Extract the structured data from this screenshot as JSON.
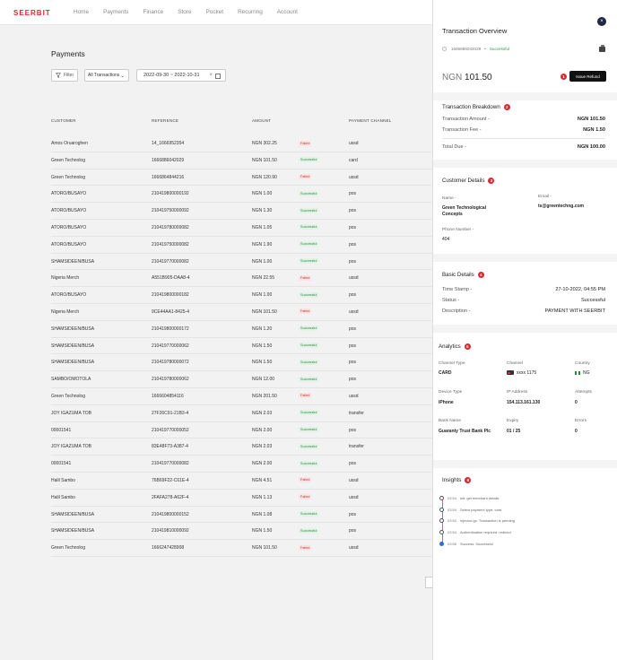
{
  "topbar": {
    "logo": "SEERBIT",
    "nav": [
      "Home",
      "Payments",
      "Finance",
      "Store",
      "Pocket",
      "Recurring",
      "Account"
    ]
  },
  "main": {
    "title": "Payments",
    "filter_label": "Filter",
    "type_select": "All Transactions",
    "date_range": "2022-09-30 ~ 2022-10-31",
    "columns": [
      "CUSTOMER",
      "REFERENCE",
      "AMOUNT",
      "PAYMENT CHANNEL"
    ],
    "rows": [
      {
        "customer": "Amos Oruaroghen",
        "reference": "14_1666952354",
        "amount": "NGN 302.25",
        "status": "Failed",
        "channel": "ussd"
      },
      {
        "customer": "Green Technolog",
        "reference": "1666886042029",
        "amount": "NGN 101.50",
        "status": "Successful",
        "channel": "card"
      },
      {
        "customer": "Green Technolog",
        "reference": "1666864844216",
        "amount": "NGN 120.90",
        "status": "Failed",
        "channel": "ussd"
      },
      {
        "customer": "ATORO/BUSAYO",
        "reference": "210419800000192",
        "amount": "NGN 1.00",
        "status": "Successful",
        "channel": "pos"
      },
      {
        "customer": "ATORO/BUSAYO",
        "reference": "210419750000092",
        "amount": "NGN 1.30",
        "status": "Successful",
        "channel": "pos"
      },
      {
        "customer": "ATORO/BUSAYO",
        "reference": "210419780000082",
        "amount": "NGN 1.05",
        "status": "Successful",
        "channel": "pos"
      },
      {
        "customer": "ATORO/BUSAYO",
        "reference": "210419750000082",
        "amount": "NGN 1.90",
        "status": "Successful",
        "channel": "pos"
      },
      {
        "customer": "SHAMSIDEEN/BUSA",
        "reference": "210419770000082",
        "amount": "NGN 1.00",
        "status": "Successful",
        "channel": "pos"
      },
      {
        "customer": "Nigeria Merch",
        "reference": "A551B905-DAA8-4",
        "amount": "NGN 22.55",
        "status": "Failed",
        "channel": "ussd"
      },
      {
        "customer": "ATORO/BUSAYO",
        "reference": "210419800000182",
        "amount": "NGN 1.00",
        "status": "Successful",
        "channel": "pos"
      },
      {
        "customer": "Nigeria Merch",
        "reference": "9CE44AA1-8425-4",
        "amount": "NGN 101.50",
        "status": "Failed",
        "channel": "ussd"
      },
      {
        "customer": "SHAMSIDEEN/BUSA",
        "reference": "210419800000172",
        "amount": "NGN 1.20",
        "status": "Successful",
        "channel": "pos"
      },
      {
        "customer": "SHAMSIDEEN/BUSA",
        "reference": "210419770000062",
        "amount": "NGN 1.50",
        "status": "Successful",
        "channel": "pos"
      },
      {
        "customer": "SHAMSIDEEN/BUSA",
        "reference": "210419780000072",
        "amount": "NGN 1.50",
        "status": "Successful",
        "channel": "pos"
      },
      {
        "customer": "SAMBO/OMOTOLA",
        "reference": "210419780000062",
        "amount": "NGN 12.00",
        "status": "Successful",
        "channel": "pos"
      },
      {
        "customer": "Green Technolog",
        "reference": "1666604854116",
        "amount": "NGN 201.50",
        "status": "Failed",
        "channel": "ussd"
      },
      {
        "customer": "JOY IGAZUMA TOB",
        "reference": "27F26C91-21B3-4",
        "amount": "NGN 2.03",
        "status": "Successful",
        "channel": "transfer"
      },
      {
        "customer": "00001541",
        "reference": "210419770000052",
        "amount": "NGN 2.00",
        "status": "Successful",
        "channel": "pos"
      },
      {
        "customer": "JOY IGAZUMA TOB",
        "reference": "83E48F73-A387-4",
        "amount": "NGN 2.03",
        "status": "Successful",
        "channel": "transfer"
      },
      {
        "customer": "00001541",
        "reference": "210419770000082",
        "amount": "NGN 2.00",
        "status": "Successful",
        "channel": "pos"
      },
      {
        "customer": "Halil Sambo",
        "reference": "76B69F22-C61E-4",
        "amount": "NGN 4.51",
        "status": "Failed",
        "channel": "ussd"
      },
      {
        "customer": "Halil Sambo",
        "reference": "2FAFA278-A62F-4",
        "amount": "NGN 1.13",
        "status": "Failed",
        "channel": "ussd"
      },
      {
        "customer": "SHAMSIDEEN/BUSA",
        "reference": "210419800000152",
        "amount": "NGN 1.08",
        "status": "Successful",
        "channel": "pos"
      },
      {
        "customer": "SHAMSIDEEN/BUSA",
        "reference": "210419810000092",
        "amount": "NGN 1.50",
        "status": "Successful",
        "channel": "pos"
      },
      {
        "customer": "Green Technolog",
        "reference": "1666247428908",
        "amount": "NGN 101.50",
        "status": "Failed",
        "channel": "ussd"
      }
    ]
  },
  "panel": {
    "title": "Transaction Overview",
    "reference": "1666886042029",
    "status": "Successful",
    "amount_currency": "NGN",
    "amount_value": "101.50",
    "refund_label": "Issue Refund",
    "breakdown": {
      "title": "Transaction Breakdown",
      "badge": "2",
      "amount_label": "Transaction Amount -",
      "amount_value": "NGN 101.50",
      "fee_label": "Transaction Fee -",
      "fee_value": "NGN 1.50",
      "total_label": "Total Due -",
      "total_value": "NGN 100.00"
    },
    "customer": {
      "title": "Customer Details",
      "badge": "3",
      "name_label": "Name -",
      "name_value": "Green Technological Concepts",
      "email_label": "Email -",
      "email_value": "ts@greentechng.com",
      "phone_label": "Phone Number -",
      "phone_value": "404"
    },
    "basic": {
      "title": "Basic Details",
      "badge": "4",
      "timestamp_label": "Time Stamp -",
      "timestamp_value": "27-10-2022, 04:55 PM",
      "status_label": "Status -",
      "status_value": "Successful",
      "description_label": "Description -",
      "description_value": "PAYMENT WITH SEERBIT"
    },
    "analytics": {
      "title": "Analytics",
      "badge": "5",
      "channel_type_label": "Channel Type",
      "channel_type_value": "CARD",
      "channel_label": "Channel",
      "channel_value": "xxxx 1175",
      "country_label": "Country",
      "country_value": "NG",
      "device_label": "Device Type",
      "device_value": "iPhone",
      "ip_label": "IP Address",
      "ip_value": "154.113.161.130",
      "attempts_label": "Attempts",
      "attempts_value": "0",
      "bank_label": "Bank Name",
      "bank_value": "Guaranty Trust Bank Plc",
      "expiry_label": "Expiry",
      "expiry_value": "01 / 25",
      "errors_label": "Errors",
      "errors_value": "0"
    },
    "insights": {
      "title": "Insights",
      "badge": "6",
      "items": [
        {
          "time": "03:54",
          "text": "init: get merchant details"
        },
        {
          "time": "03:54",
          "text": "Select payment type: card"
        },
        {
          "time": "03:54",
          "text": "Injector-gc: Transaction is pending"
        },
        {
          "time": "03:54",
          "text": "Authentication required: redirect"
        },
        {
          "time": "03:55",
          "text": "Success: Successful"
        }
      ]
    }
  },
  "colors": {
    "brand": "#e0262f",
    "success": "#2f9a48",
    "failed": "#b33333",
    "timeline": "#2bb5a6"
  }
}
